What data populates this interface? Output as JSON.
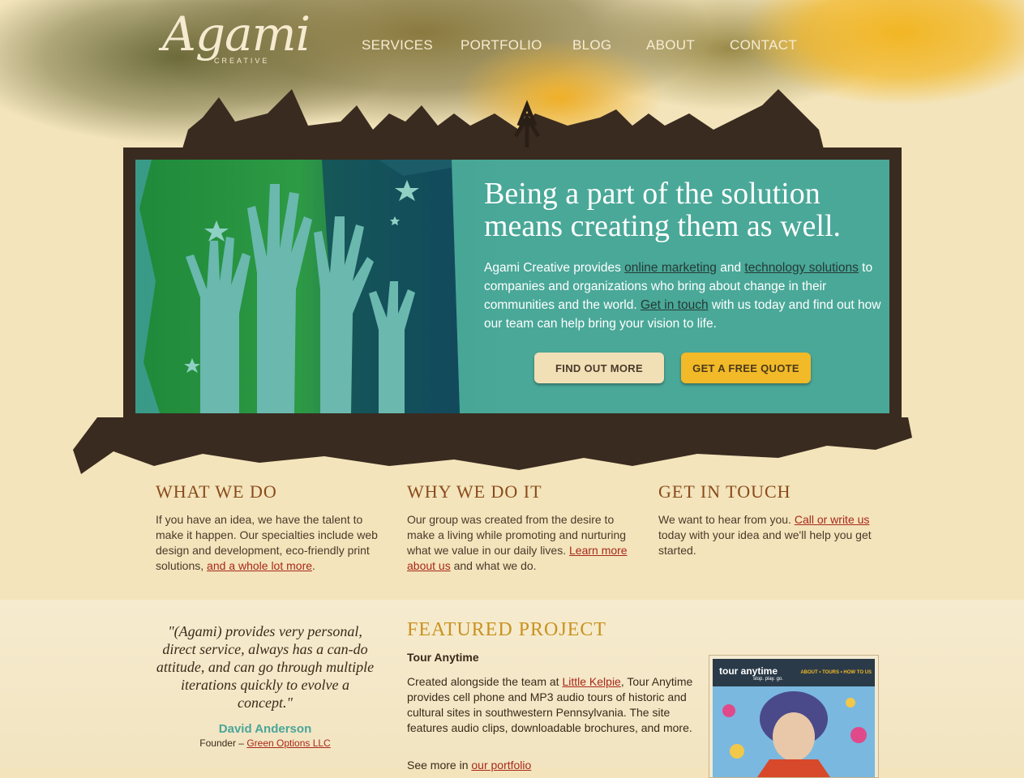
{
  "brand": {
    "name": "Agami",
    "tagline": "CREATIVE"
  },
  "nav": [
    {
      "label": "SERVICES"
    },
    {
      "label": "PORTFOLIO"
    },
    {
      "label": "BLOG"
    },
    {
      "label": "ABOUT"
    },
    {
      "label": "CONTACT"
    }
  ],
  "hero": {
    "title_line1": "Being a part of the solution",
    "title_line2": "means creating them as well.",
    "text_1": "Agami Creative provides ",
    "link_online": "online marketing",
    "text_2": " and ",
    "link_tech": "technology solutions",
    "text_3": " to companies and organizations who bring about change in their communities and the world. ",
    "link_touch": "Get in touch",
    "text_4": " with us today and find out how our team can help bring your vision to life.",
    "btn_more": "FIND OUT MORE",
    "btn_quote": "GET A FREE QUOTE"
  },
  "columns": {
    "what": {
      "title": "WHAT WE DO",
      "text": "If you have an idea, we have the talent to make it happen. Our specialties include web design and development, eco-friendly print solutions, ",
      "link": "and a whole lot more",
      "text_after": "."
    },
    "why": {
      "title": "WHY WE DO IT",
      "text": "Our group was created from the desire to make a living while promoting and nurturing what we value in our daily lives. ",
      "link": "Learn more about us",
      "text_after": " and what we do."
    },
    "touch": {
      "title": "GET IN TOUCH",
      "text": "We want to hear from you. ",
      "link": "Call or write us",
      "text_after": " today with your idea and we'll help you get started."
    }
  },
  "testimonial": {
    "quote": "\"(Agami) provides very personal, direct service, always has a can-do attitude, and can go through multiple iterations quickly to evolve a concept.\"",
    "name": "David Anderson",
    "role": "Founder – ",
    "company": "Green Options LLC"
  },
  "featured": {
    "title": "FEATURED PROJECT",
    "project": "Tour Anytime",
    "text_1": "Created alongside the team at ",
    "link": "Little Kelpie",
    "text_2": ", Tour Anytime provides cell phone and MP3 audio tours of historic and cultural sites in southwestern Pennsylvania. The site features audio clips, downloadable brochures, and more.",
    "more_text": "See more in ",
    "more_link": "our portfolio",
    "thumb": {
      "logo": "tour anytime",
      "tag": "stop. play. go.",
      "nav": "ABOUT  •  TOURS  •  HOW TO US"
    }
  },
  "colors": {
    "background": "#f3e4bb",
    "hero": "#4aa898",
    "frame": "#3a2b20",
    "heading": "#8a4a1c",
    "accent": "#f2b928",
    "link": "#a8281a"
  }
}
